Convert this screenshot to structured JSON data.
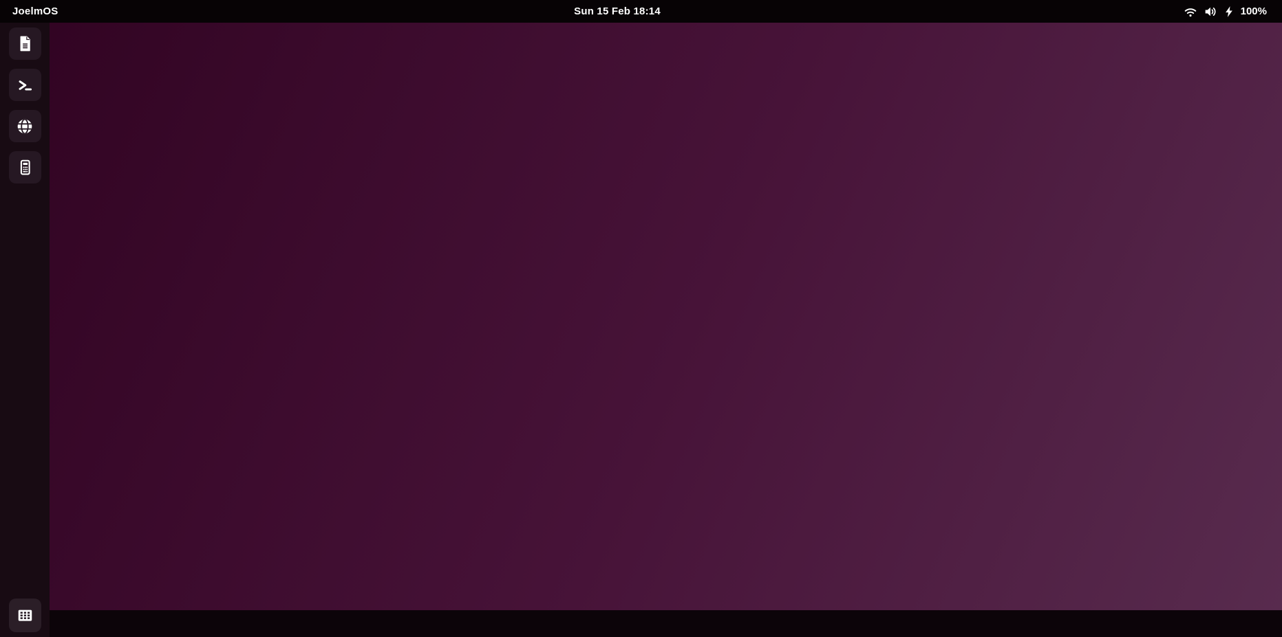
{
  "topbar": {
    "app_name": "JoelmOS",
    "clock": "Sun 15 Feb 18:14",
    "status": {
      "wifi_icon": "wifi-signal",
      "volume_icon": "speaker-volume",
      "power_icon": "charging-bolt",
      "battery_percent": "100%"
    }
  },
  "dock": {
    "items": [
      {
        "name": "text-editor",
        "icon": "document-icon"
      },
      {
        "name": "terminal",
        "icon": "terminal-icon"
      },
      {
        "name": "browser",
        "icon": "globe-icon"
      },
      {
        "name": "calculator",
        "icon": "calculator-icon"
      }
    ],
    "show_apps": {
      "name": "show-applications",
      "icon": "apps-grid-icon"
    }
  },
  "colors": {
    "topbar_bg": "#070305",
    "dock_bg": "#180b13",
    "dock_button_bg": "#261823",
    "show_apps_button_bg": "#2b1e27",
    "desktop_gradient_start": "#320423",
    "desktop_gradient_mid": "#471338",
    "desktop_gradient_end": "#582b4e",
    "bottom_strip_bg": "#0c0409",
    "icon_color": "#ffffff",
    "text_color": "#ffffff"
  }
}
